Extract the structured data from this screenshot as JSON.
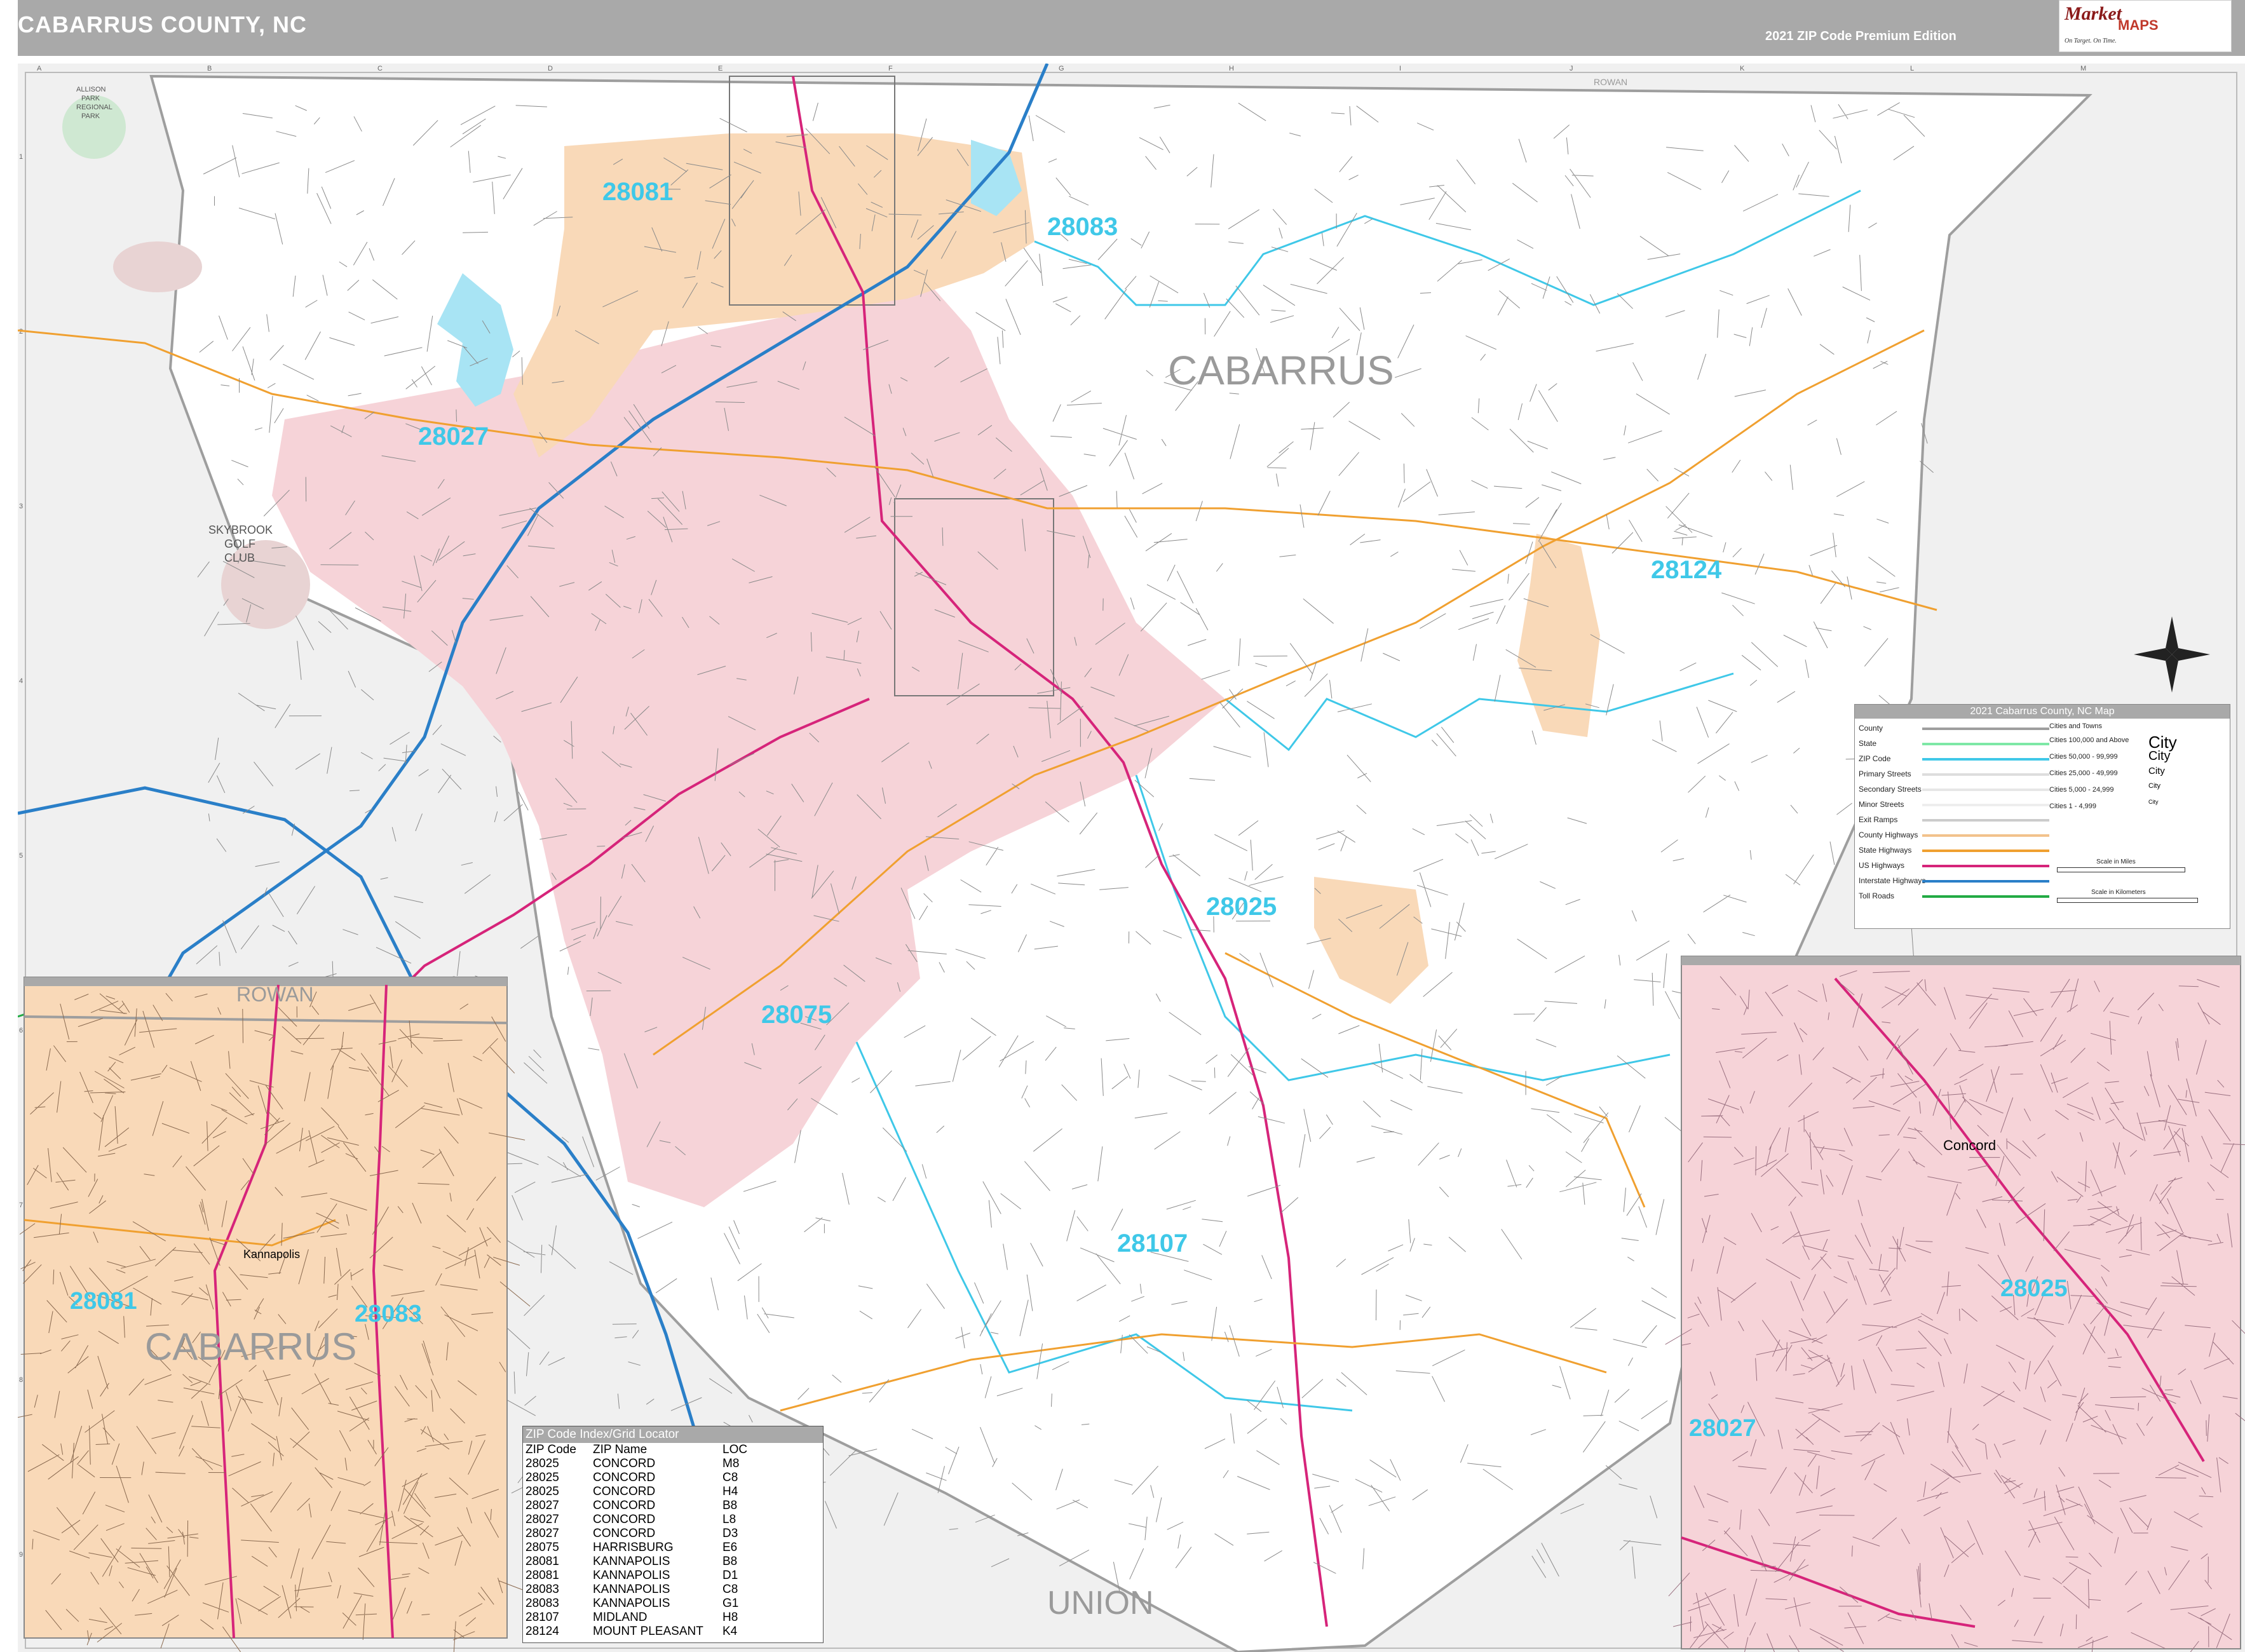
{
  "header": {
    "title": "CABARRUS COUNTY, NC",
    "edition": "2021 ZIP Code Premium Edition"
  },
  "logo": {
    "market": "Market",
    "maps": "MAPS",
    "tagline": "On Target. On Time."
  },
  "grid": {
    "columns": [
      "A",
      "B",
      "C",
      "D",
      "E",
      "F",
      "G",
      "H",
      "I",
      "J",
      "K",
      "L",
      "M"
    ],
    "rows": [
      "1",
      "2",
      "3",
      "4",
      "5",
      "6",
      "7",
      "8",
      "9"
    ]
  },
  "labels": {
    "county_main": "CABARRUS",
    "county_inset": "CABARRUS",
    "rowan_top": "ROWAN",
    "rowan_inset": "ROWAN",
    "union": "UNION",
    "skybrook": [
      "SKYBROOK",
      "GOLF",
      "CLUB"
    ],
    "allison": [
      "ALLISON",
      "PARK",
      "REGIONAL",
      "PARK"
    ],
    "concord_inset": "Concord",
    "kannapolis_inset": "Kannapolis"
  },
  "zip_labels": {
    "z28081": "28081",
    "z28083": "28083",
    "z28027": "28027",
    "z28124": "28124",
    "z28025": "28025",
    "z28075": "28075",
    "z28107": "28107",
    "inset_left_28081": "28081",
    "inset_left_28083": "28083",
    "inset_right_28025": "28025",
    "inset_right_28027": "28027"
  },
  "legend": {
    "title": "2021 Cabarrus County, NC Map",
    "rows": [
      "County",
      "State",
      "ZIP Code",
      "Primary Streets",
      "Secondary Streets",
      "Minor Streets",
      "Exit Ramps",
      "County Highways",
      "State Highways",
      "US Highways",
      "Interstate Highways",
      "Toll Roads"
    ],
    "cities_title": "Cities and Towns",
    "cities": [
      {
        "label": "Cities 100,000 and Above",
        "sample": "City"
      },
      {
        "label": "Cities 50,000 - 99,999",
        "sample": "City"
      },
      {
        "label": "Cities 25,000 - 49,999",
        "sample": "City"
      },
      {
        "label": "Cities 5,000 - 24,999",
        "sample": "City"
      },
      {
        "label": "Cities 1 - 4,999",
        "sample": "City"
      }
    ],
    "scale_miles": "Scale in Miles",
    "scale_km": "Scale in Kilometers",
    "colors": {
      "county": "#9e9e9e",
      "state": "#7ee8a6",
      "zip": "#3fc8e8",
      "state_hwy": "#f0a030",
      "us_hwy": "#d6247a",
      "interstate": "#2a7fc8",
      "toll": "#22aa44"
    }
  },
  "zip_index": {
    "title": "ZIP Code Index/Grid Locator",
    "headers": [
      "ZIP Code",
      "ZIP Name",
      "LOC"
    ],
    "rows": [
      [
        "28025",
        "CONCORD",
        "M8"
      ],
      [
        "28025",
        "CONCORD",
        "C8"
      ],
      [
        "28025",
        "CONCORD",
        "H4"
      ],
      [
        "28027",
        "CONCORD",
        "B8"
      ],
      [
        "28027",
        "CONCORD",
        "L8"
      ],
      [
        "28027",
        "CONCORD",
        "D3"
      ],
      [
        "28075",
        "HARRISBURG",
        "E6"
      ],
      [
        "28081",
        "KANNAPOLIS",
        "B8"
      ],
      [
        "28081",
        "KANNAPOLIS",
        "D1"
      ],
      [
        "28083",
        "KANNAPOLIS",
        "C8"
      ],
      [
        "28083",
        "KANNAPOLIS",
        "G1"
      ],
      [
        "28107",
        "MIDLAND",
        "H8"
      ],
      [
        "28124",
        "MOUNT PLEASANT",
        "K4"
      ]
    ]
  },
  "colors": {
    "pink": "#f6d3d8",
    "orange": "#f9d9b8",
    "outside": "#f0f0f0",
    "zip_text": "#3fc8e8",
    "water": "#a8e4f4",
    "park": "#cfe8d2"
  }
}
